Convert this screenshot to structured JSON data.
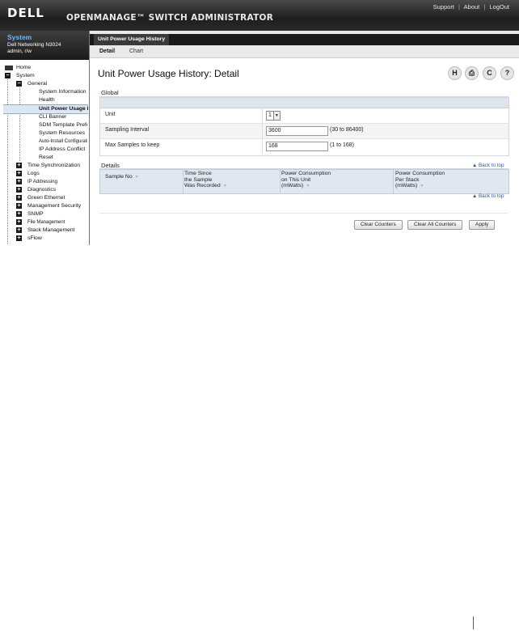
{
  "header": {
    "logo": "DELL",
    "app_title": "OPENMANAGE™ SWITCH ADMINISTRATOR",
    "links": [
      "Support",
      "About",
      "LogOut"
    ],
    "separator": "|"
  },
  "sidebar": {
    "system_title": "System",
    "model": "Dell Networking N3024",
    "user": "admin, r/w",
    "tree": [
      {
        "label": "Home"
      },
      {
        "label": "System",
        "toggle": "−"
      },
      {
        "label": "General",
        "toggle": "−"
      },
      {
        "label": "System Information"
      },
      {
        "label": "Health"
      },
      {
        "label": "Unit Power Usage History"
      },
      {
        "label": "CLI Banner"
      },
      {
        "label": "SDM Template Preference"
      },
      {
        "label": "System Resources"
      },
      {
        "label": "Auto-Install Configuration"
      },
      {
        "label": "IP Address Conflict"
      },
      {
        "label": "Reset"
      },
      {
        "label": "Time Synchronization",
        "toggle": "+"
      },
      {
        "label": "Logs",
        "toggle": "+"
      },
      {
        "label": "IP Addressing",
        "toggle": "+"
      },
      {
        "label": "Diagnostics",
        "toggle": "+"
      },
      {
        "label": "Green Ethernet",
        "toggle": "+"
      },
      {
        "label": "Management Security",
        "toggle": "+"
      },
      {
        "label": "SNMP",
        "toggle": "+"
      },
      {
        "label": "File Management",
        "toggle": "+"
      },
      {
        "label": "Stack Management",
        "toggle": "+"
      },
      {
        "label": "sFlow",
        "toggle": "+"
      }
    ]
  },
  "main": {
    "page_tab": "Unit Power Usage History",
    "subtabs": [
      "Detail",
      "Chart"
    ],
    "title": "Unit Power Usage History: Detail",
    "icons": [
      "save-icon",
      "print-icon",
      "refresh-icon",
      "help-icon"
    ],
    "icon_glyphs": [
      "H",
      "⎙",
      "C",
      "?"
    ],
    "global": {
      "heading": "Global",
      "unit_label": "Unit",
      "unit_value": "1",
      "sampling_label": "Sampling Interval",
      "sampling_value": "3600",
      "sampling_range": "(30 to 86400)",
      "max_label": "Max Samples to keep",
      "max_value": "168",
      "max_range": "(1 to 168)"
    },
    "details": {
      "heading": "Details",
      "back_to_top": "▲ Back to top",
      "columns": [
        [
          "",
          "",
          "Sample No"
        ],
        [
          "Time Since",
          "the Sample",
          "Was Recorded"
        ],
        [
          "Power Consumption",
          "on This Unit",
          "(mWatts)"
        ],
        [
          "Power Consumption",
          "Per Stack",
          "(mWatts)"
        ]
      ]
    },
    "buttons": [
      "Clear Counters",
      "Clear All Counters",
      "Apply"
    ]
  }
}
